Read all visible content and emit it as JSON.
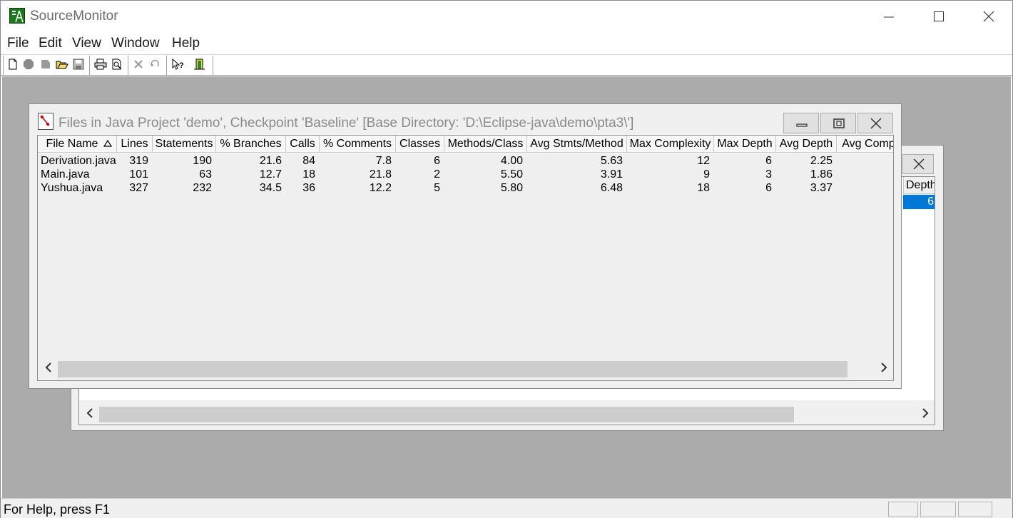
{
  "app": {
    "title": "SourceMonitor"
  },
  "menu": [
    "File",
    "Edit",
    "View",
    "Window",
    "Help"
  ],
  "toolbar": {
    "icons": [
      "new-file-icon",
      "checkpoint-icon",
      "checkpoint-gray-icon",
      "open-folder-icon",
      "save-icon",
      "print-icon",
      "print-preview-icon",
      "delete-icon",
      "undo-icon",
      "context-help-icon",
      "exit-icon"
    ]
  },
  "background_window": {
    "header_fragment": "Depth",
    "selected_value": "6"
  },
  "files_window": {
    "title": "Files in Java Project 'demo', Checkpoint 'Baseline'  [Base Directory: 'D:\\Eclipse-java\\demo\\pta3\\']",
    "columns": [
      "File Name",
      "Lines",
      "Statements",
      "% Branches",
      "Calls",
      "% Comments",
      "Classes",
      "Methods/Class",
      "Avg Stmts/Method",
      "Max Complexity",
      "Max Depth",
      "Avg Depth",
      "Avg Comp"
    ],
    "rows": [
      [
        "Derivation.java",
        "319",
        "190",
        "21.6",
        "84",
        "7.8",
        "6",
        "4.00",
        "5.63",
        "12",
        "6",
        "2.25"
      ],
      [
        "Main.java",
        "101",
        "63",
        "12.7",
        "18",
        "21.8",
        "2",
        "5.50",
        "3.91",
        "9",
        "3",
        "1.86"
      ],
      [
        "Yushua.java",
        "327",
        "232",
        "34.5",
        "36",
        "12.2",
        "5",
        "5.80",
        "6.48",
        "18",
        "6",
        "3.37"
      ]
    ]
  },
  "status": {
    "text": "For Help, press F1"
  }
}
